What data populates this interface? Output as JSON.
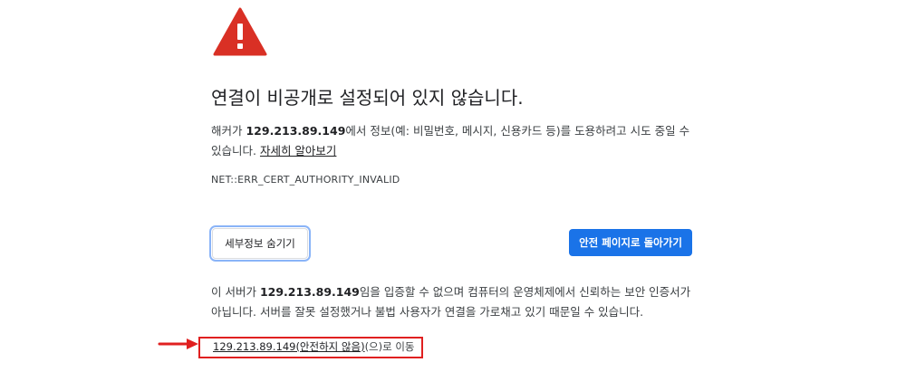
{
  "interstitial": {
    "title": "연결이 비공개로 설정되어 있지 않습니다.",
    "description": {
      "prefix": "해커가 ",
      "host": "129.213.89.149",
      "suffix": "에서 정보(예: 비밀번호, 메시지, 신용카드 등)를 도용하려고 시도 중일 수 있습니다. ",
      "learn_more": "자세히 알아보기"
    },
    "error_code": "NET::ERR_CERT_AUTHORITY_INVALID",
    "buttons": {
      "hide_details": "세부정보 숨기기",
      "back_to_safety": "안전 페이지로 돌아가기"
    },
    "details": {
      "prefix": "이 서버가 ",
      "host": "129.213.89.149",
      "suffix": "임을 입증할 수 없으며 컴퓨터의 운영체제에서 신뢰하는 보안 인증서가 아닙니다. 서버를 잘못 설정했거나 불법 사용자가 연결을 가로채고 있기 때문일 수 있습니다."
    },
    "proceed": {
      "link": "129.213.89.149(안전하지 않음)",
      "suffix": "(으)로 이동"
    }
  },
  "colors": {
    "warning": "#d93025",
    "accent": "#1a73e8",
    "annotation": "#e02020"
  },
  "icons": {
    "warning": "warning-triangle-icon",
    "annotation": "red-arrow-icon"
  }
}
